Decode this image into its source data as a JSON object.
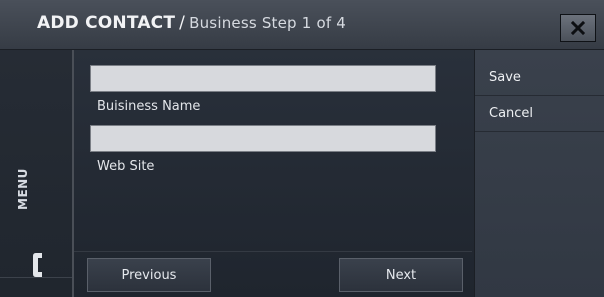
{
  "header": {
    "title_main": "ADD CONTACT",
    "title_sep": "/",
    "title_sub": "Business Step 1 of 4",
    "close_icon": "close-x-icon"
  },
  "sidebar": {
    "menu_label": "MENU",
    "phone_icon": "phone-icon"
  },
  "form": {
    "fields": [
      {
        "label": "Buisiness Name",
        "value": ""
      },
      {
        "label": "Web Site",
        "value": ""
      }
    ]
  },
  "navigation": {
    "previous_label": "Previous",
    "next_label": "Next"
  },
  "actions": {
    "save_label": "Save",
    "cancel_label": "Cancel"
  }
}
